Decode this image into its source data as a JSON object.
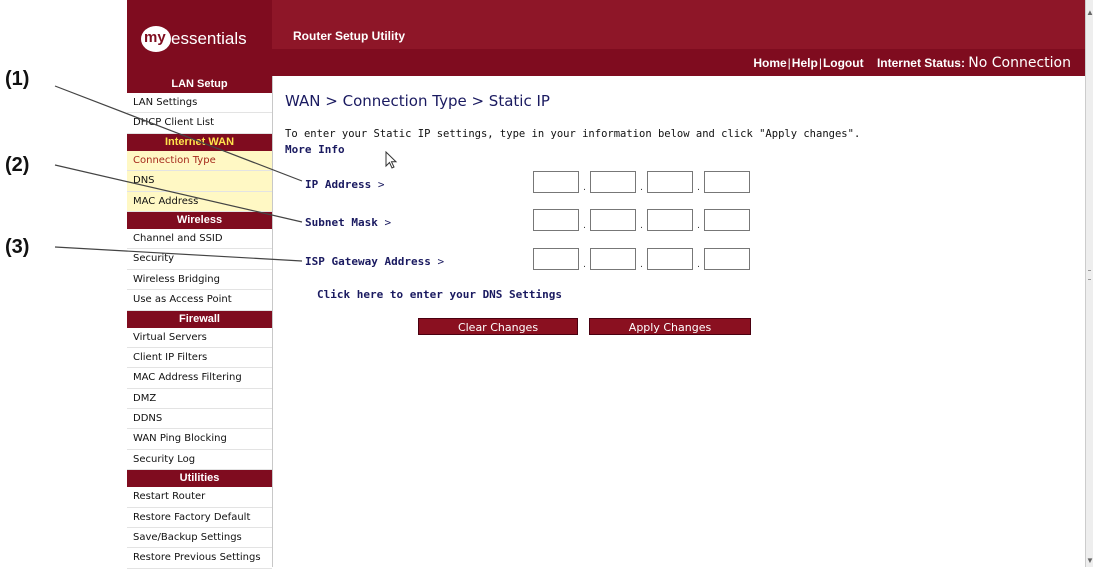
{
  "callouts": [
    "(1)",
    "(2)",
    "(3)"
  ],
  "brand": {
    "my": "my",
    "name": "essentials"
  },
  "app_title": "Router Setup Utility",
  "topnav": {
    "home": "Home",
    "help": "Help",
    "logout": "Logout",
    "status_label": "Internet Status:",
    "status_value": "No Connection"
  },
  "sidebar": {
    "lan_setup": "LAN Setup",
    "lan_items": [
      "LAN Settings",
      "DHCP Client List"
    ],
    "internet_wan": "Internet WAN",
    "wan_items": [
      "Connection Type",
      "DNS",
      "MAC Address"
    ],
    "wireless": "Wireless",
    "wireless_items": [
      "Channel and SSID",
      "Security",
      "Wireless Bridging",
      "Use as Access Point"
    ],
    "firewall": "Firewall",
    "firewall_items": [
      "Virtual Servers",
      "Client IP Filters",
      "MAC Address Filtering",
      "DMZ",
      "DDNS",
      "WAN Ping Blocking",
      "Security Log"
    ],
    "utilities": "Utilities",
    "utilities_items": [
      "Restart Router",
      "Restore Factory Default",
      "Save/Backup Settings",
      "Restore Previous Settings"
    ]
  },
  "main": {
    "title": "WAN > Connection Type > Static IP",
    "intro": "To enter your Static IP settings, type in your information below and click \"Apply changes\".",
    "more_info": "More Info",
    "fields": {
      "ip_address": "IP Address",
      "subnet_mask": "Subnet Mask",
      "gateway": "ISP Gateway Address",
      "arrow": ">"
    },
    "ip_values": {
      "ip": [
        "",
        "",
        "",
        ""
      ],
      "subnet": [
        "",
        "",
        "",
        ""
      ],
      "gateway": [
        "",
        "",
        "",
        ""
      ]
    },
    "dns_link": "Click here to enter your DNS Settings",
    "clear_button": "Clear Changes",
    "apply_button": "Apply Changes"
  },
  "colors": {
    "brand_red": "#7f0c1f",
    "link_blue": "#1a1a60",
    "active_bg": "#fff8c4"
  }
}
